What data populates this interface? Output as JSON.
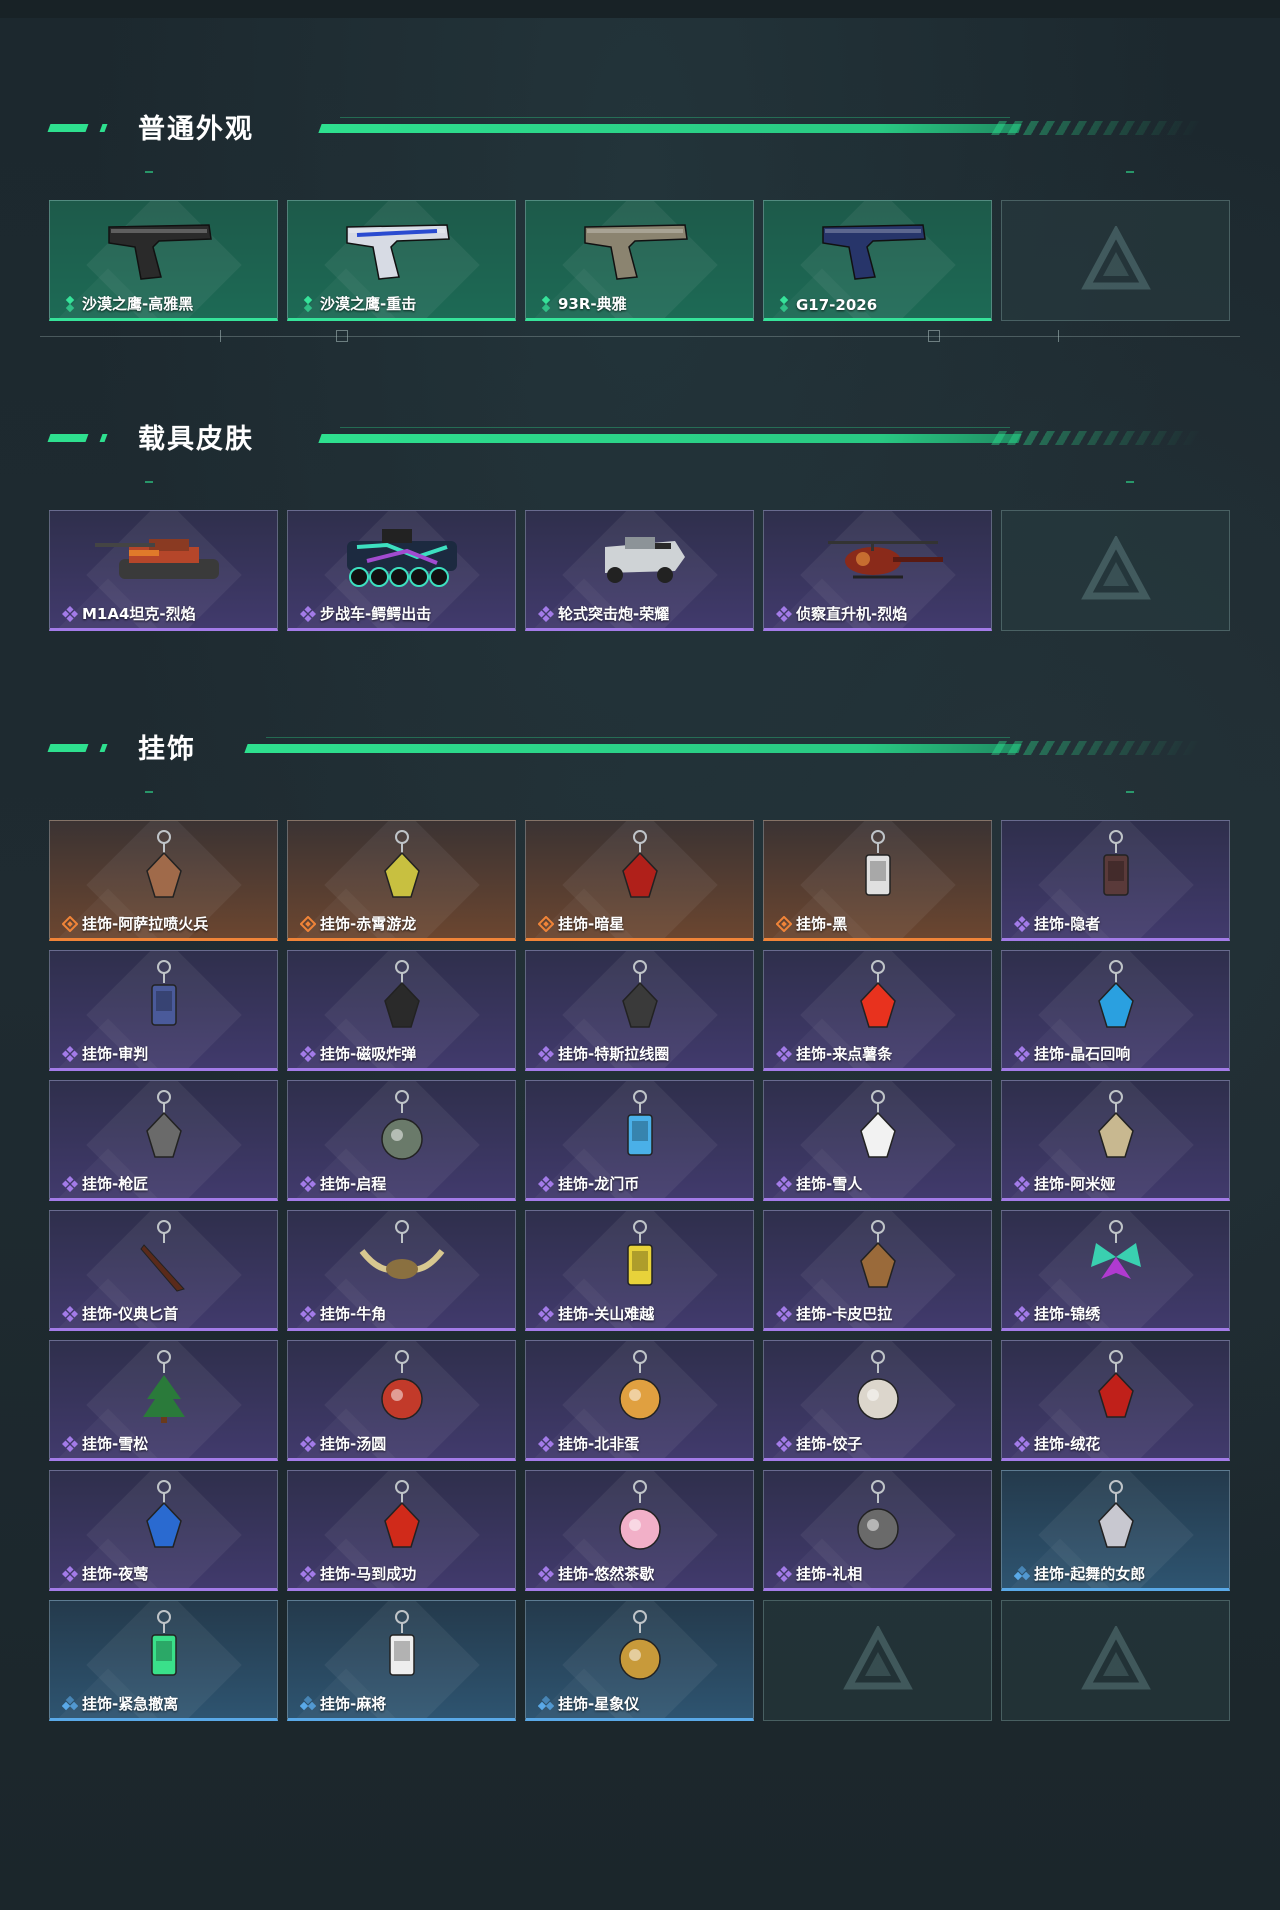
{
  "sections": [
    {
      "title": "普通外观",
      "items": [
        {
          "name": "沙漠之鹰-高雅黑",
          "rarity": "green",
          "icon": "pistol-black-icon"
        },
        {
          "name": "沙漠之鹰-重击",
          "rarity": "green",
          "icon": "pistol-white-blue-icon"
        },
        {
          "name": "93R-典雅",
          "rarity": "green",
          "icon": "pistol-tan-icon"
        },
        {
          "name": "G17-2026",
          "rarity": "green",
          "icon": "pistol-navy-icon"
        },
        {
          "name": "",
          "rarity": "empty",
          "icon": "empty-slot-logo-icon"
        }
      ]
    },
    {
      "title": "载具皮肤",
      "items": [
        {
          "name": "M1A4坦克-烈焰",
          "rarity": "purple",
          "icon": "tank-icon"
        },
        {
          "name": "步战车-鳄鳄出击",
          "rarity": "purple",
          "icon": "ifv-icon"
        },
        {
          "name": "轮式突击炮-荣耀",
          "rarity": "purple",
          "icon": "wheeled-gun-icon"
        },
        {
          "name": "侦察直升机-烈焰",
          "rarity": "purple",
          "icon": "helicopter-icon"
        },
        {
          "name": "",
          "rarity": "empty",
          "icon": "empty-slot-logo-icon"
        }
      ]
    },
    {
      "title": "挂饰",
      "items": [
        {
          "name": "挂饰-阿萨拉喷火兵",
          "rarity": "orange",
          "icon": "charm-flamer-icon"
        },
        {
          "name": "挂饰-赤霄游龙",
          "rarity": "orange",
          "icon": "charm-dragon-icon"
        },
        {
          "name": "挂饰-暗星",
          "rarity": "orange",
          "icon": "charm-darkstar-icon"
        },
        {
          "name": "挂饰-黑",
          "rarity": "orange",
          "icon": "charm-black-icon"
        },
        {
          "name": "挂饰-隐者",
          "rarity": "purple",
          "icon": "charm-hermit-icon"
        },
        {
          "name": "挂饰-审判",
          "rarity": "purple",
          "icon": "charm-judge-icon"
        },
        {
          "name": "挂饰-磁吸炸弹",
          "rarity": "purple",
          "icon": "charm-bomb-icon"
        },
        {
          "name": "挂饰-特斯拉线圈",
          "rarity": "purple",
          "icon": "charm-tesla-icon"
        },
        {
          "name": "挂饰-来点薯条",
          "rarity": "purple",
          "icon": "charm-fries-icon"
        },
        {
          "name": "挂饰-晶石回响",
          "rarity": "purple",
          "icon": "charm-crystal-icon"
        },
        {
          "name": "挂饰-枪匠",
          "rarity": "purple",
          "icon": "charm-gunsmith-icon"
        },
        {
          "name": "挂饰-启程",
          "rarity": "purple",
          "icon": "charm-journey-icon"
        },
        {
          "name": "挂饰-龙门币",
          "rarity": "purple",
          "icon": "charm-coin-icon"
        },
        {
          "name": "挂饰-雪人",
          "rarity": "purple",
          "icon": "charm-snowman-icon"
        },
        {
          "name": "挂饰-阿米娅",
          "rarity": "purple",
          "icon": "charm-amiya-icon"
        },
        {
          "name": "挂饰-仪典匕首",
          "rarity": "purple",
          "icon": "charm-dagger-icon"
        },
        {
          "name": "挂饰-牛角",
          "rarity": "purple",
          "icon": "charm-horn-icon"
        },
        {
          "name": "挂饰-关山难越",
          "rarity": "purple",
          "icon": "charm-scroll-icon"
        },
        {
          "name": "挂饰-卡皮巴拉",
          "rarity": "purple",
          "icon": "charm-capybara-icon"
        },
        {
          "name": "挂饰-锦绣",
          "rarity": "purple",
          "icon": "charm-butterfly-icon"
        },
        {
          "name": "挂饰-雪松",
          "rarity": "purple",
          "icon": "charm-tree-icon"
        },
        {
          "name": "挂饰-汤圆",
          "rarity": "purple",
          "icon": "charm-tangyuan-icon"
        },
        {
          "name": "挂饰-北非蛋",
          "rarity": "purple",
          "icon": "charm-shakshuka-icon"
        },
        {
          "name": "挂饰-饺子",
          "rarity": "purple",
          "icon": "charm-dumpling-icon"
        },
        {
          "name": "挂饰-绒花",
          "rarity": "purple",
          "icon": "charm-flower-icon"
        },
        {
          "name": "挂饰-夜莺",
          "rarity": "purple",
          "icon": "charm-feather-icon"
        },
        {
          "name": "挂饰-马到成功",
          "rarity": "purple",
          "icon": "charm-horse-icon"
        },
        {
          "name": "挂饰-悠然茶歇",
          "rarity": "purple",
          "icon": "charm-cupcake-icon"
        },
        {
          "name": "挂饰-礼相",
          "rarity": "purple",
          "icon": "charm-hat-icon"
        },
        {
          "name": "挂饰-起舞的女郎",
          "rarity": "blue",
          "icon": "charm-dancer-icon"
        },
        {
          "name": "挂饰-紧急撤离",
          "rarity": "blue",
          "icon": "charm-exit-icon"
        },
        {
          "name": "挂饰-麻将",
          "rarity": "blue",
          "icon": "charm-mahjong-icon"
        },
        {
          "name": "挂饰-星象仪",
          "rarity": "blue",
          "icon": "charm-astrolabe-icon"
        },
        {
          "name": "",
          "rarity": "empty",
          "icon": "empty-slot-logo-icon"
        },
        {
          "name": "",
          "rarity": "empty",
          "icon": "empty-slot-logo-icon"
        }
      ]
    }
  ],
  "colors": {
    "accent": "#2ee08f",
    "green": "#36e39a",
    "purple": "#a37be8",
    "orange": "#f08438",
    "blue": "#5aa9e8"
  }
}
